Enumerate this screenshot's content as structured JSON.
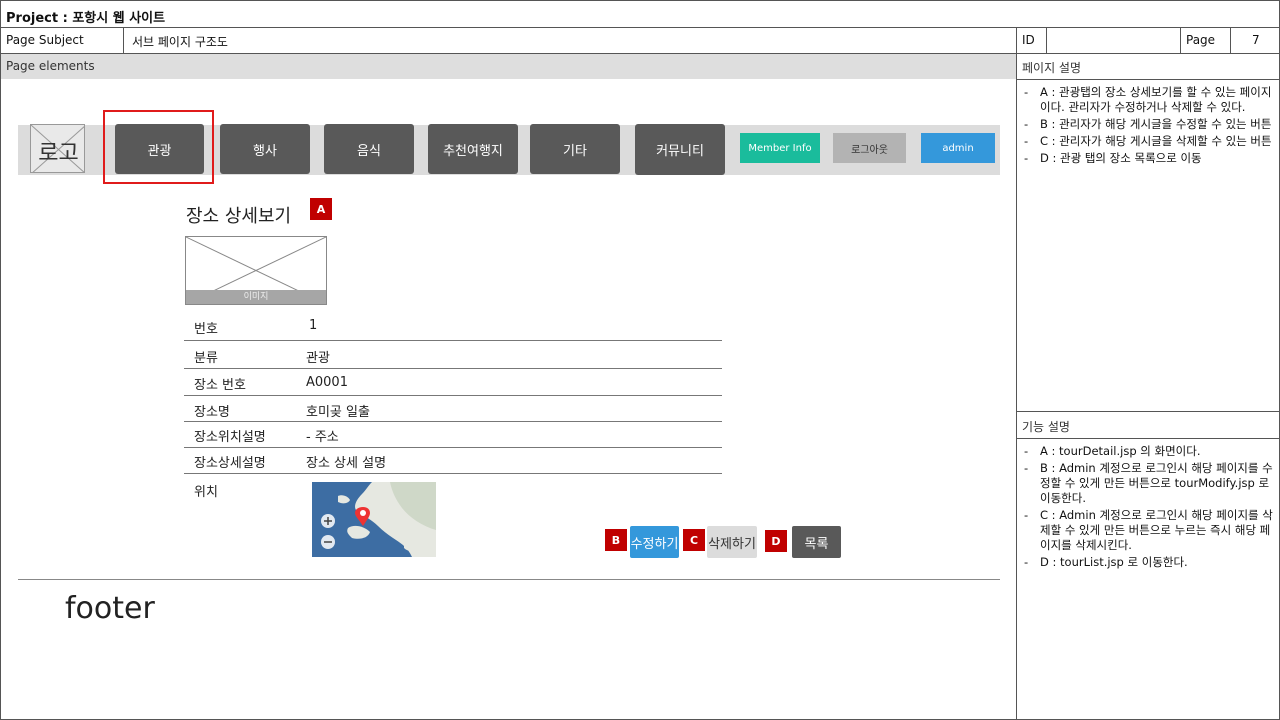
{
  "header": {
    "project": "Project : 포항시 웹 사이트",
    "page_subject_label": "Page Subject",
    "page_subject_value": "서브 페이지 구조도",
    "id_label": "ID",
    "id_value": "",
    "page_label": "Page",
    "page_value": "7"
  },
  "elements_label": "Page elements",
  "page_desc": {
    "title": "페이지 설명",
    "items": [
      "A : 관광탭의 장소 상세보기를 할 수 있는 페이지이다. 관리자가 수정하거나 삭제할 수 있다.",
      "B : 관리자가 해당 게시글을 수정할 수 있는 버튼",
      "C : 관리자가 해당 게시글을 삭제할 수 있는 버튼",
      "D : 관광 탭의 장소 목록으로 이동"
    ]
  },
  "func_desc": {
    "title": "기능 설명",
    "items": [
      "A : tourDetail.jsp 의 화면이다.",
      "B : Admin 계정으로 로그인시 해당 페이지를 수정할 수 있게 만든 버튼으로 tourModify.jsp 로 이동한다.",
      "C : Admin 계정으로 로그인시 해당 페이지를 삭제할 수 있게 만든 버튼으로 누르는 즉시 해당 페이지를 삭제시킨다.",
      "D : tourList.jsp 로 이동한다."
    ]
  },
  "nav": {
    "logo": "로고",
    "items": [
      "관광",
      "행사",
      "음식",
      "추천여행지",
      "기타",
      "커뮤니티"
    ],
    "member_info": "Member Info",
    "logout": "로그아웃",
    "admin": "admin"
  },
  "detail": {
    "title": "장소 상세보기",
    "image_caption": "이미지",
    "rows": [
      {
        "label": "번호",
        "value": "1"
      },
      {
        "label": "분류",
        "value": "관광"
      },
      {
        "label": "장소 번호",
        "value": "A0001"
      },
      {
        "label": "장소명",
        "value": "호미곶 일출"
      },
      {
        "label": "장소위치설명",
        "value": "- 주소"
      },
      {
        "label": "장소상세설명",
        "value": "장소 상세 설명"
      },
      {
        "label": "위치",
        "value": ""
      }
    ]
  },
  "markers": {
    "a": "A",
    "b": "B",
    "c": "C",
    "d": "D"
  },
  "actions": {
    "modify": "수정하기",
    "delete": "삭제하기",
    "list": "목록"
  },
  "footer": "footer",
  "colors": {
    "nav_button": "#595959",
    "member_info": "#1abc9c",
    "logout": "#b3b3b3",
    "admin": "#3498db",
    "marker": "#c00000",
    "highlight": "#e01b1b",
    "modify_button": "#3498db",
    "delete_button": "#dcdcdc",
    "list_button": "#595959"
  }
}
